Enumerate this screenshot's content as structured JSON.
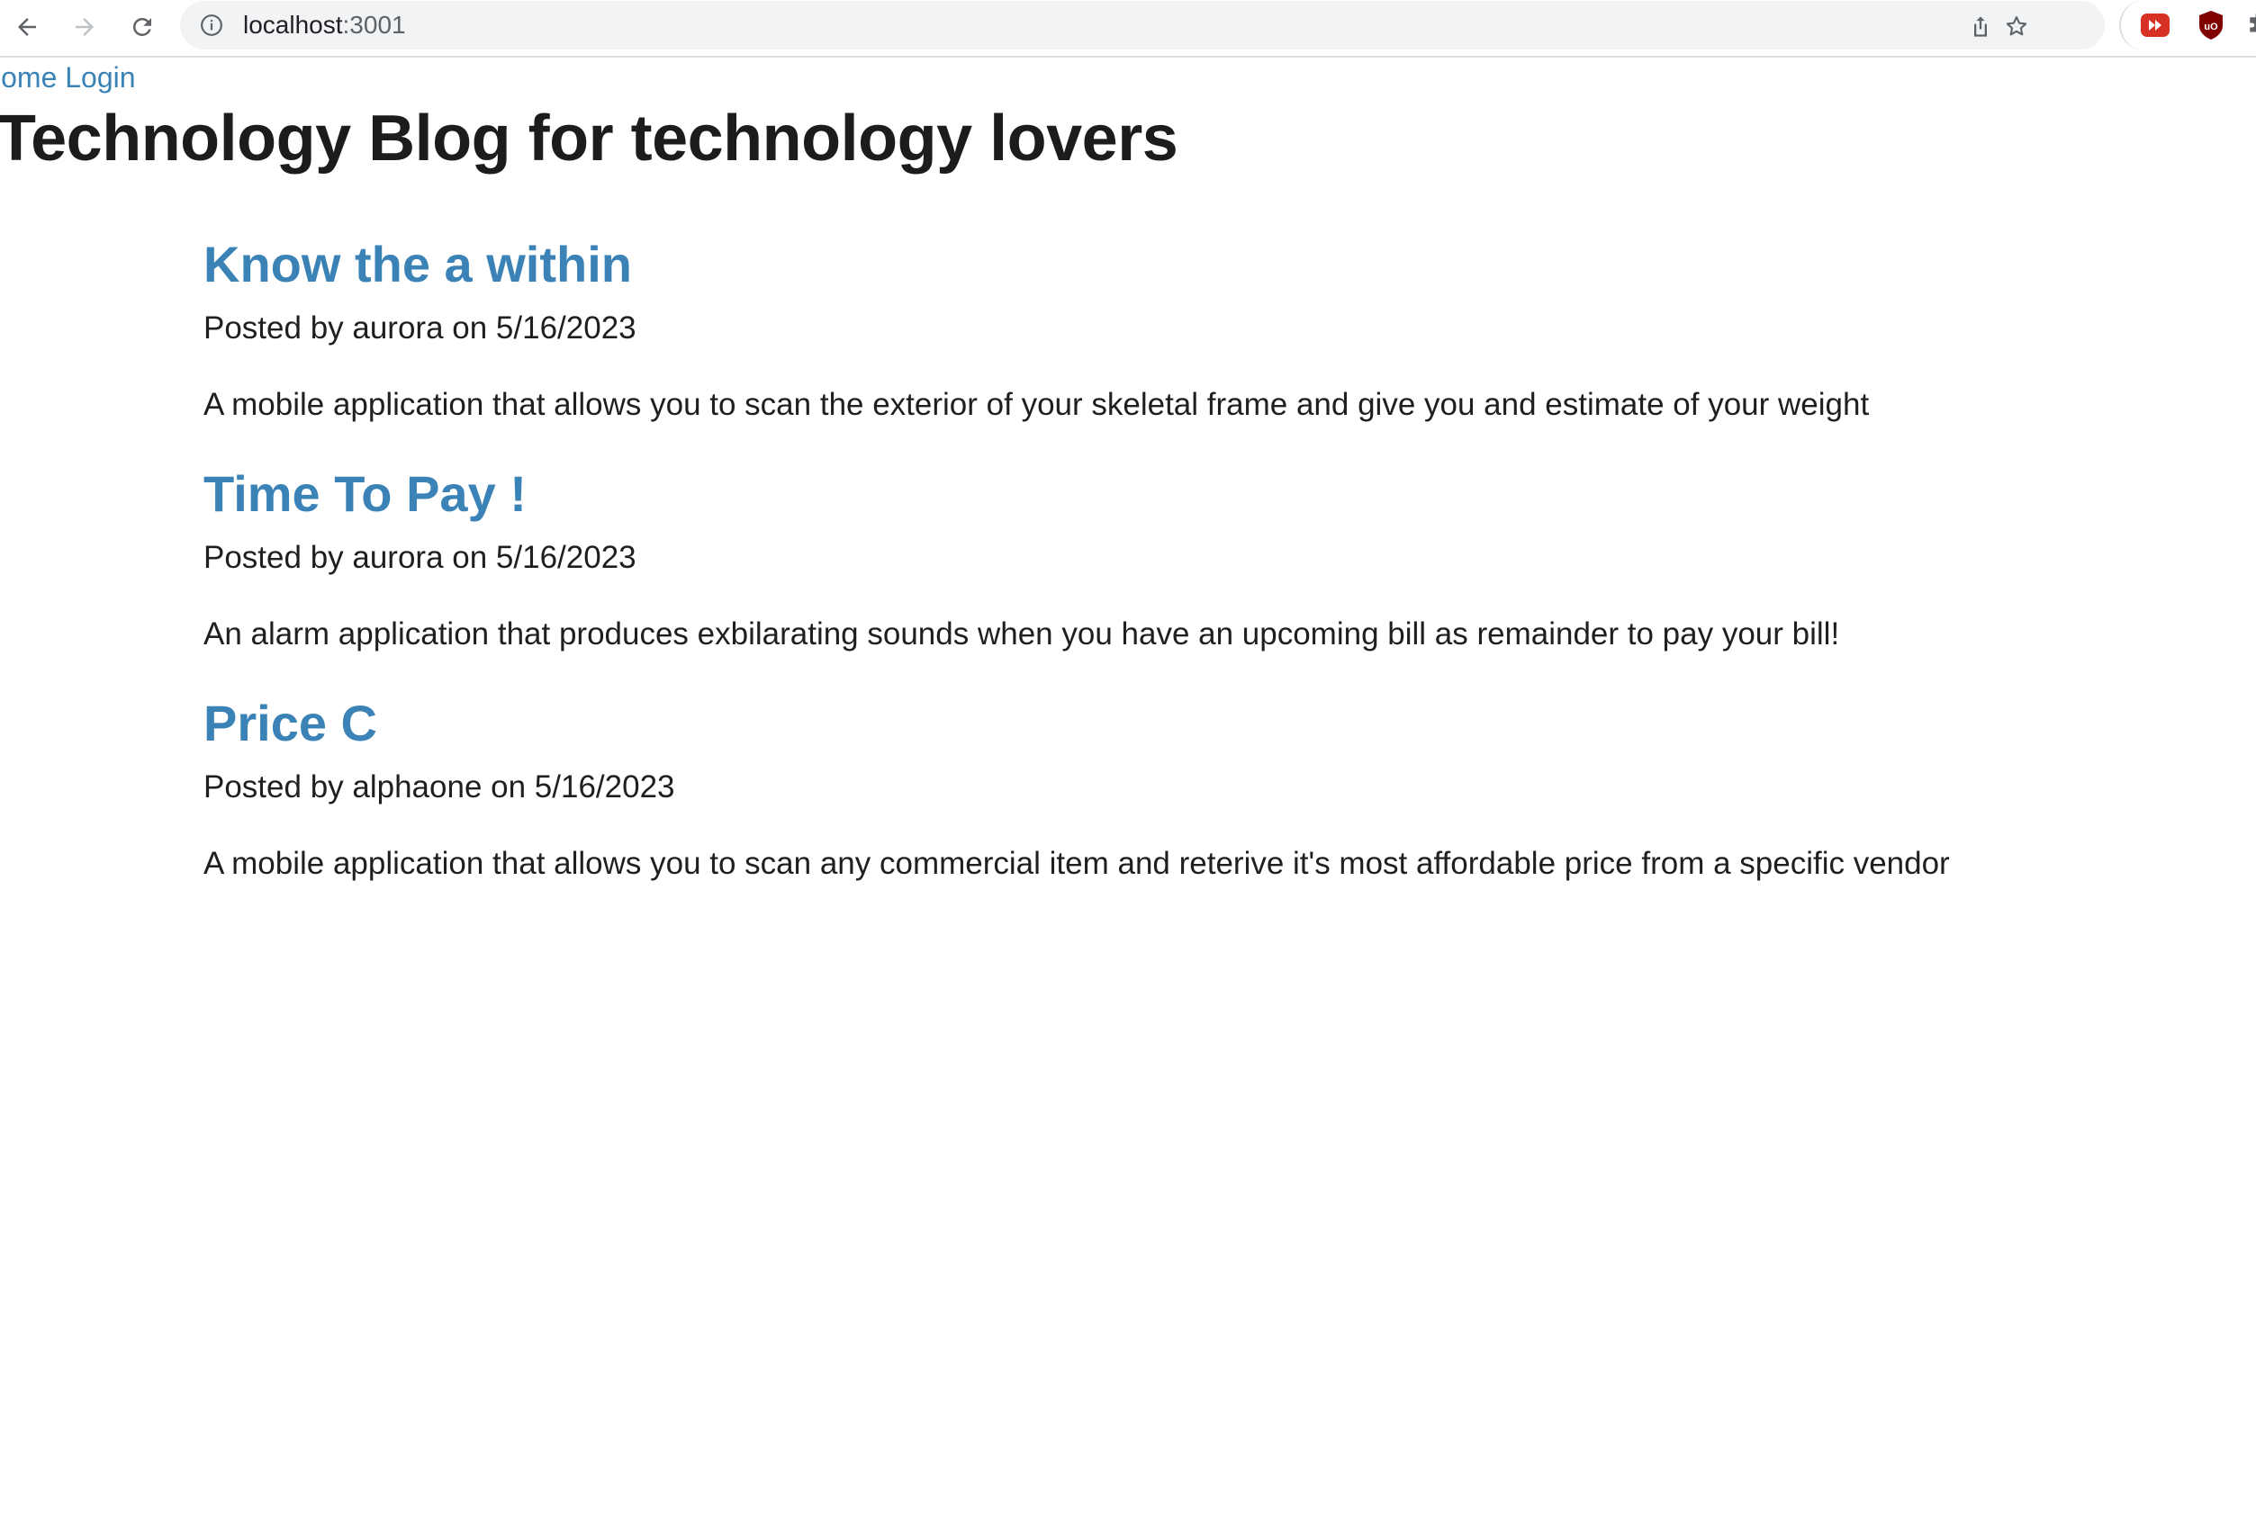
{
  "browser": {
    "url_host": "localhost",
    "url_port": ":3001",
    "icons": {
      "back": "back-arrow-icon",
      "forward": "forward-arrow-icon",
      "reload": "reload-icon",
      "site_info": "info-icon",
      "share": "share-icon",
      "bookmark": "star-icon",
      "extension_1": "youtube-extension-icon",
      "extension_2": "ublock-extension-icon",
      "extensions_menu": "puzzle-icon"
    },
    "extension_2_text": "uO"
  },
  "nav": {
    "home_label": "Home",
    "login_label": "Login"
  },
  "site": {
    "title": "Technology Blog for technology lovers"
  },
  "posts": [
    {
      "title": "Know the a within",
      "meta": "Posted by aurora on 5/16/2023",
      "body": "A mobile application that allows you to scan the exterior of your skeletal frame and give you and estimate of your weight"
    },
    {
      "title": "Time To Pay !",
      "meta": "Posted by aurora on 5/16/2023",
      "body": "An alarm application that produces exbilarating sounds when you have an upcoming bill as remainder to pay your bill!"
    },
    {
      "title": "Price C",
      "meta": "Posted by alphaone on 5/16/2023",
      "body": "A mobile application that allows you to scan any commercial item and reterive it's most affordable price from a specific vendor"
    }
  ],
  "colors": {
    "link": "#3b83b7",
    "text": "#1f1f1f",
    "omnibox": "#f1f3f4"
  }
}
